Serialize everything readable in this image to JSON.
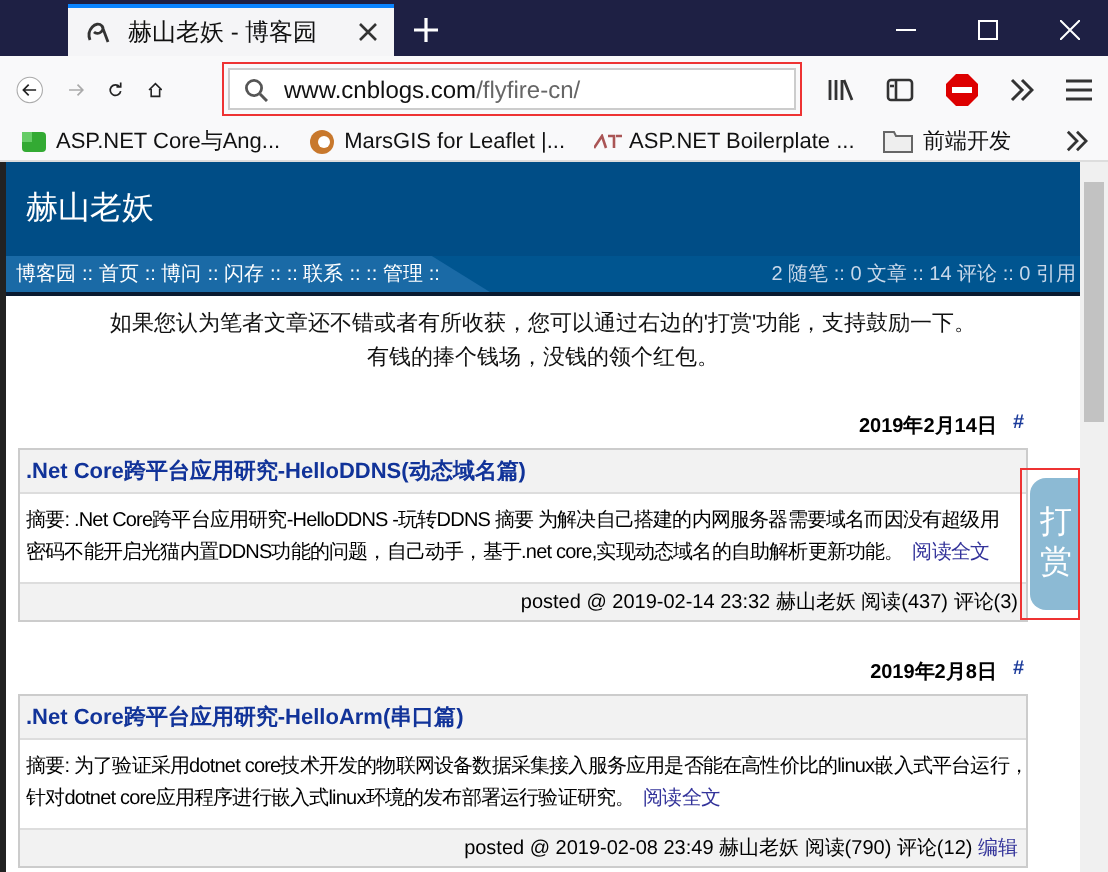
{
  "browser": {
    "tab_title": "赫山老妖 - 博客园",
    "url_host": "www.cnblogs.com",
    "url_path": "/flyfire-cn/",
    "bookmarks": [
      {
        "label": "ASP.NET Core与Ang...",
        "kind": "green"
      },
      {
        "label": "MarsGIS for Leaflet |...",
        "kind": "swirl"
      },
      {
        "label": "ASP.NET Boilerplate ...",
        "kind": "abp"
      },
      {
        "label": "前端开发",
        "kind": "folder"
      }
    ]
  },
  "blog": {
    "title": "赫山老妖",
    "nav": [
      "博客园",
      ":: 首页",
      ":: 博问",
      ":: 闪存",
      ":: :: 联系",
      ":: :: 管理",
      ":: "
    ],
    "stats": "2 随笔 :: 0 文章 :: 14 评论 :: 0 引用",
    "notice": [
      "如果您认为笔者文章还不错或者有所收获，您可以通过右边的'打赏'功能，支持鼓励一下。",
      "有钱的捧个钱场，没钱的领个红包。"
    ],
    "reward_button": "打赏",
    "posts": [
      {
        "date": "2019年2月14日",
        "anchor": "#",
        "title": ".Net Core跨平台应用研究-HelloDDNS(动态域名篇)",
        "summary": "摘要: .Net Core跨平台应用研究-HelloDDNS -玩转DDNS 摘要 为解决自己搭建的内网服务器需要域名而因没有超级用",
        "summary_2": "密码不能开启光猫内置DDNS功能的问题，自己动手，基于.net core,实现动态域名的自助解析更新功能。",
        "read_more": "阅读全文",
        "footer": "posted @ 2019-02-14 23:32 赫山老妖 阅读(437) 评论(3)"
      },
      {
        "date": "2019年2月8日",
        "anchor": "#",
        "title": ".Net Core跨平台应用研究-HelloArm(串口篇)",
        "summary": "摘要: 为了验证采用dotnet core技术开发的物联网设备数据采集接入服务应用是否能在高性价比的linux嵌入式平台运行，",
        "summary_2": "针对dotnet core应用程序进行嵌入式linux环境的发布部署运行验证研究。",
        "read_more": "阅读全文",
        "footer": "posted @ 2019-02-08 23:49 赫山老妖 阅读(790) 评论(12)",
        "edit": "编辑"
      }
    ]
  }
}
